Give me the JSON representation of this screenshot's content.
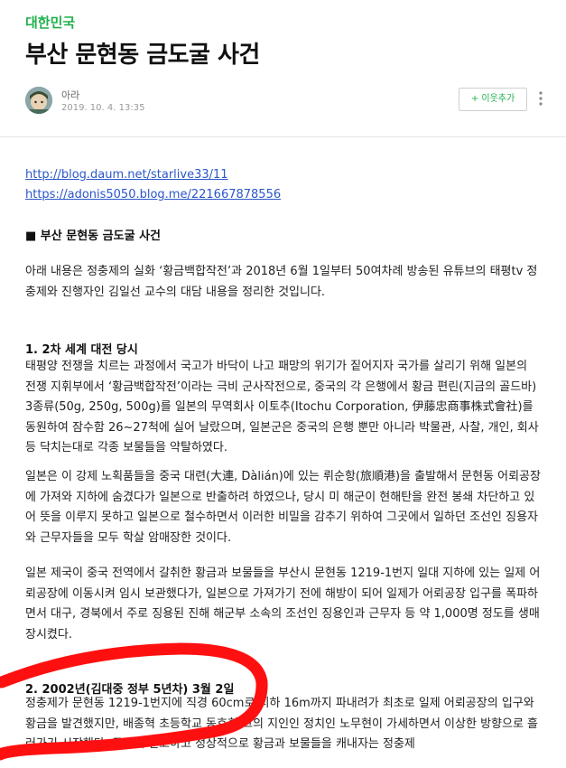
{
  "post": {
    "category": "대한민국",
    "title": "부산 문현동 금도굴 사건"
  },
  "author": {
    "name": "아라",
    "date": "2019. 10. 4. 13:35",
    "follow_label": "+ 이웃추가"
  },
  "icons": {
    "avatar": "avatar-icon",
    "more": "more-vertical-icon"
  },
  "content": {
    "links": [
      "http://blog.daum.net/starlive33/11",
      "https://adonis5050.blog.me/221667878556"
    ],
    "heading": "■ 부산 문현동 금도굴 사건",
    "intro": "아래 내용은 정충제의 실화 ‘황금백합작전’과 2018년 6월 1일부터 50여차례 방송된 유튜브의 태평tv 정충제와 진행자인 김일선 교수의 대담 내용을 정리한 것입니다.",
    "section1_title": "1. 2차 세계 대전 당시",
    "section1_p1": " 태평양 전쟁을 치르는 과정에서 국고가 바닥이 나고 패망의 위기가 짙어지자 국가를 살리기 위해 일본의 전쟁 지휘부에서 ‘황금백합작전’이라는 극비 군사작전으로, 중국의 각 은행에서 황금 편린(지금의 골드바) 3종류(50g, 250g, 500g)를 일본의 무역회사 이토추(Itochu Corporation, 伊藤忠商事株式會社)를 동원하여 잠수함 26~27척에 실어 날랐으며, 일본군은 중국의 은행 뿐만 아니라 박물관, 사찰, 개인, 회사 등 닥치는대로 각종 보물들을 약탈하였다.",
    "section1_p2": "일본은 이 강제 노획품들을 중국 대련(大連, Dàlián)에 있는 뤼순항(旅順港)을 출발해서 문현동 어뢰공장에 가져와 지하에 숨겼다가 일본으로 반출하려 하였으나, 당시 미 해군이 현해탄을 완전 봉쇄 차단하고 있어 뜻을 이루지 못하고 일본으로 철수하면서 이러한 비밀을 감추기 위하여 그곳에서 일하던 조선인 징용자와 근무자들을 모두 학살 암매장한 것이다.",
    "section1_p3": " 일본 제국이 중국 전역에서 갈취한 황금과 보물들을 부산시 문현동 1219-1번지 일대 지하에 있는 일제 어뢰공장에 이동시켜 임시 보관했다가, 일본으로 가져가기 전에 해방이 되어 일제가 어뢰공장 입구를 폭파하면서 대구, 경북에서 주로 징용된 진해 해군부 소속의 조선인 징용인과 근무자 등 약 1,000명 정도를 생매장시켰다.",
    "section2_title": "2. 2002년(김대중 정부 5년차) 3월 2일",
    "section2_p1": " 정충제가 문현동 1219-1번지에 직경 60cm로 지하 16m까지 파내려가 최초로 일제 어뢰공장의 입구와 황금을 발견했지만, 배종혁 초등학교 동호회 그의 지인인 정치인 노무현이 가세하면서 이상한 방향으로 흘러가기 시작했다. 국가에 신고하고 정상적으로 황금과 보물들을 캐내자는 정충제"
  }
}
